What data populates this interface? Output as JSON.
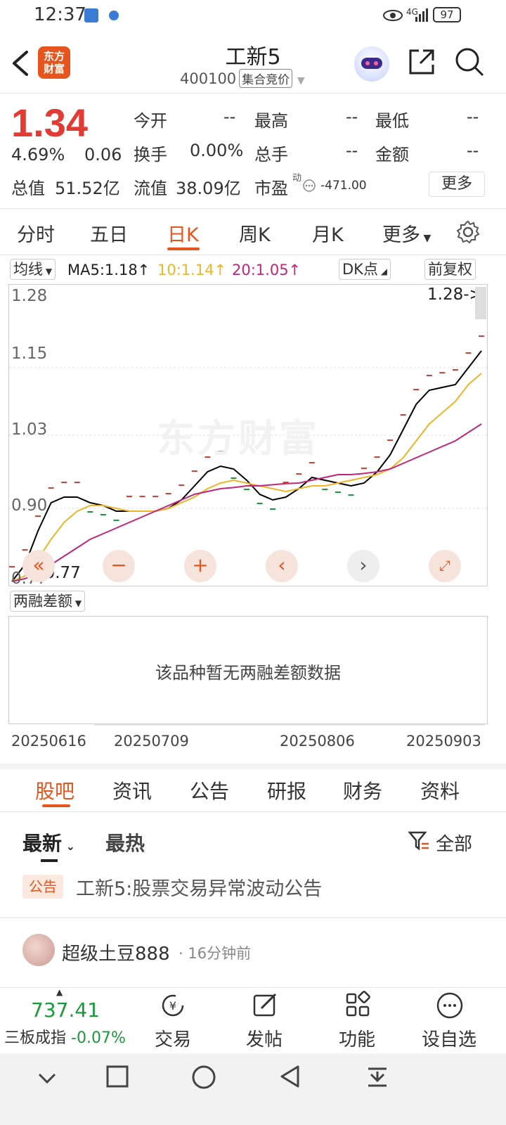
{
  "status_bar": {
    "time": "12:37",
    "network": "4G",
    "battery": "97"
  },
  "header": {
    "app_logo": "东方\n财富",
    "title": "工新5",
    "code": "400100",
    "status_tag": "集合竞价"
  },
  "quote": {
    "price": "1.34",
    "change_pct": "4.69%",
    "change_amt": "0.06",
    "fields": {
      "open_label": "今开",
      "open_val": "--",
      "high_label": "最高",
      "high_val": "--",
      "low_label": "最低",
      "low_val": "--",
      "turnover_label": "换手",
      "turnover_val": "0.00%",
      "volume_label": "总手",
      "volume_val": "--",
      "amount_label": "金额",
      "amount_val": "--",
      "mktcap_label": "总值",
      "mktcap_val": "51.52亿",
      "float_label": "流值",
      "float_val": "38.09亿",
      "pe_label": "市盈",
      "pe_sup": "动",
      "pe_val": "-471.00"
    },
    "more_label": "更多"
  },
  "chart_tabs": [
    "分时",
    "五日",
    "日K",
    "周K",
    "月K",
    "更多"
  ],
  "chart_controls": {
    "ma_select": "均线",
    "ma5": "MA5:1.18↑",
    "ma10": "10:1.14↑",
    "ma20": "20:1.05↑",
    "dk": "DK点",
    "adjust": "前复权",
    "high_label": "1.28->",
    "low_label": "<-0.77"
  },
  "chart_data": {
    "type": "line",
    "y_ticks": [
      "1.28",
      "1.15",
      "1.03",
      "0.90",
      "0.77"
    ],
    "ylim": [
      0.77,
      1.28
    ],
    "series": [
      {
        "name": "MA5",
        "color": "#000000",
        "values": [
          0.77,
          0.8,
          0.86,
          0.91,
          0.92,
          0.92,
          0.91,
          0.905,
          0.895,
          0.895,
          0.895,
          0.895,
          0.9,
          0.915,
          0.94,
          0.965,
          0.975,
          0.97,
          0.95,
          0.925,
          0.915,
          0.92,
          0.935,
          0.955,
          0.95,
          0.945,
          0.94,
          0.945,
          0.965,
          0.995,
          1.04,
          1.085,
          1.11,
          1.115,
          1.12,
          1.15,
          1.18
        ]
      },
      {
        "name": "MA10",
        "color": "#f0b429",
        "values": [
          0.77,
          0.78,
          0.81,
          0.845,
          0.875,
          0.895,
          0.905,
          0.905,
          0.9,
          0.895,
          0.895,
          0.895,
          0.9,
          0.91,
          0.92,
          0.935,
          0.945,
          0.95,
          0.945,
          0.94,
          0.935,
          0.93,
          0.935,
          0.94,
          0.94,
          0.945,
          0.95,
          0.955,
          0.96,
          0.97,
          0.99,
          1.02,
          1.05,
          1.07,
          1.09,
          1.12,
          1.14
        ]
      },
      {
        "name": "MA20",
        "color": "#c0267a",
        "values": [
          0.77,
          0.775,
          0.785,
          0.8,
          0.815,
          0.83,
          0.845,
          0.855,
          0.865,
          0.875,
          0.885,
          0.895,
          0.905,
          0.915,
          0.925,
          0.93,
          0.935,
          0.937,
          0.94,
          0.94,
          0.942,
          0.944,
          0.945,
          0.95,
          0.955,
          0.96,
          0.96,
          0.962,
          0.965,
          0.97,
          0.98,
          0.99,
          1.0,
          1.01,
          1.02,
          1.035,
          1.05
        ]
      }
    ],
    "x_labels": [
      "20250616",
      "20250709",
      "20250806",
      "20250903"
    ]
  },
  "margin": {
    "select": "两融差额",
    "empty_text": "该品种暂无两融差额数据"
  },
  "bottom_tabs": [
    "股吧",
    "资讯",
    "公告",
    "研报",
    "财务",
    "资料"
  ],
  "feed": {
    "sort_latest": "最新",
    "sort_hot": "最热",
    "filter": "全部",
    "announcement_tag": "公告",
    "announcement_text": "工新5:股票交易异常波动公告",
    "post_user": "超级土豆888",
    "post_time": "16分钟前"
  },
  "bottom_bar": {
    "index_value": "737.41",
    "index_name": "三板成指",
    "index_change": "-0.07%",
    "trade": "交易",
    "post": "发帖",
    "functions": "功能",
    "watchlist": "设自选"
  }
}
